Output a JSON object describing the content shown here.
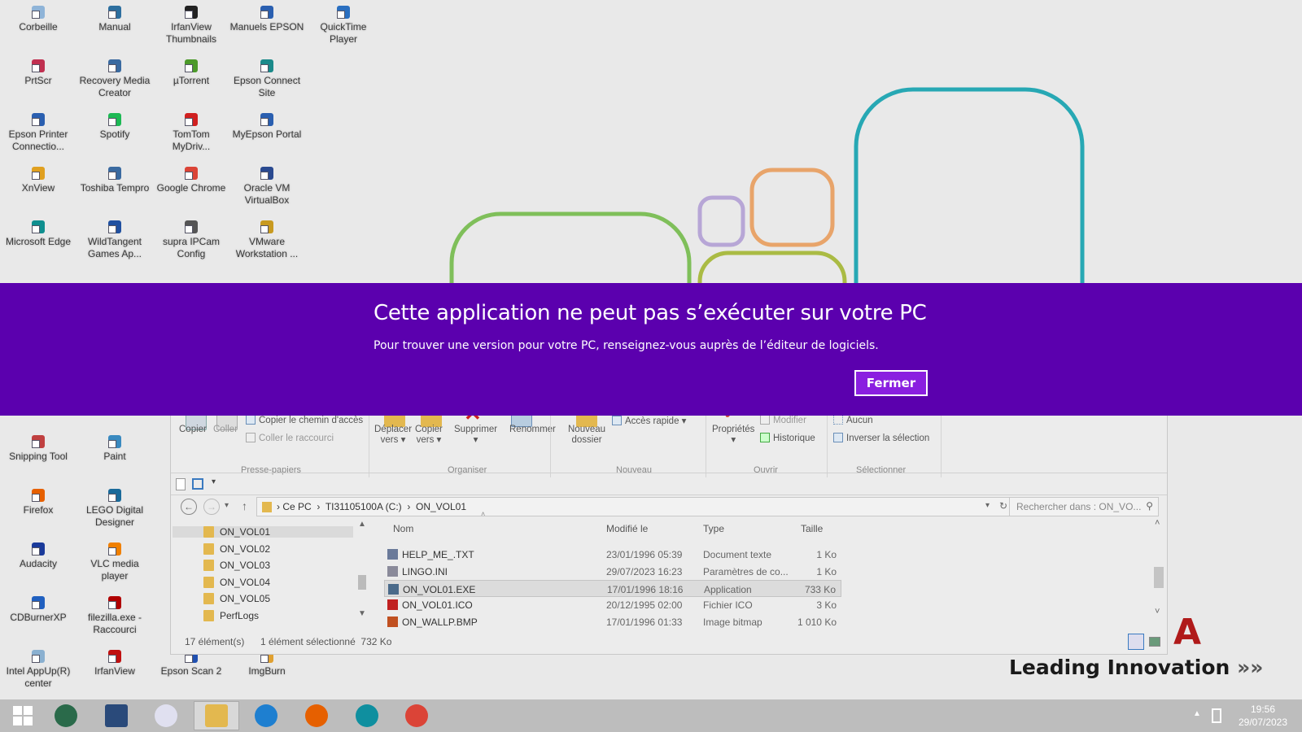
{
  "desktop": {
    "icons": [
      {
        "label": "Corbeille",
        "color": "#8fb4d8"
      },
      {
        "label": "Manual",
        "color": "#2d6f9f"
      },
      {
        "label": "IrfanView Thumbnails",
        "color": "#222"
      },
      {
        "label": "Manuels EPSON",
        "color": "#2a5fb0"
      },
      {
        "label": "QuickTime Player",
        "color": "#2a6fc0"
      },
      {
        "label": "PrtScr",
        "color": "#c03050"
      },
      {
        "label": "Recovery Media Creator",
        "color": "#3a6aa0"
      },
      {
        "label": "µTorrent",
        "color": "#4c9a2a"
      },
      {
        "label": "Epson Connect Site",
        "color": "#1b8a8a"
      },
      {
        "label": "Epson Printer Connectio...",
        "color": "#2a5fb0"
      },
      {
        "label": "Spotify",
        "color": "#1db954"
      },
      {
        "label": "TomTom MyDriv...",
        "color": "#d02020"
      },
      {
        "label": "MyEpson Portal",
        "color": "#2a5fb0"
      },
      {
        "label": "XnView",
        "color": "#e0a020"
      },
      {
        "label": "Toshiba Tempro",
        "color": "#3a6aa0"
      },
      {
        "label": "Google Chrome",
        "color": "#db4437"
      },
      {
        "label": "Oracle VM VirtualBox",
        "color": "#2a4a90"
      },
      {
        "label": "Microsoft Edge",
        "color": "#0f8f8f"
      },
      {
        "label": "WildTangent Games Ap...",
        "color": "#2050a0"
      },
      {
        "label": "supra IPCam Config",
        "color": "#555"
      },
      {
        "label": "VMware Workstation ...",
        "color": "#c89a20"
      },
      {
        "label": "Snipping Tool",
        "color": "#c04040"
      },
      {
        "label": "Paint",
        "color": "#3a8ac0"
      },
      {
        "label": "Firefox",
        "color": "#e66000"
      },
      {
        "label": "LEGO Digital Designer",
        "color": "#1a6a9a"
      },
      {
        "label": "Audacity",
        "color": "#1a3a9a"
      },
      {
        "label": "VLC media player",
        "color": "#f08000"
      },
      {
        "label": "CDBurnerXP",
        "color": "#2060c0"
      },
      {
        "label": "filezilla.exe - Raccourci",
        "color": "#b00000"
      },
      {
        "label": "Intel AppUp(R) center",
        "color": "#8ab0d0"
      },
      {
        "label": "IrfanView",
        "color": "#c01010"
      },
      {
        "label": "Epson Scan 2",
        "color": "#2050b0"
      },
      {
        "label": "ImgBurn",
        "color": "#e0a030"
      }
    ]
  },
  "dialog": {
    "title": "Cette application ne peut pas s’exécuter sur votre PC",
    "message": "Pour trouver une version pour votre PC, renseignez-vous auprès de l’éditeur de logiciels.",
    "close_label": "Fermer",
    "background": "#5b00ae"
  },
  "ribbon": {
    "copy": "Copier",
    "paste": "Coller",
    "copy_path": "Copier le chemin d'accès",
    "paste_shortcut": "Coller le raccourci",
    "move_to": [
      "Déplacer",
      "vers"
    ],
    "copy_to": [
      "Copier",
      "vers"
    ],
    "delete": "Supprimer",
    "rename": "Renommer",
    "new_folder": [
      "Nouveau",
      "dossier"
    ],
    "quick_access": "Accès rapide",
    "properties": "Propriétés",
    "edit": "Modifier",
    "history": "Historique",
    "select_none": "Aucun",
    "invert_selection": "Inverser la sélection",
    "groups": {
      "clipboard": "Presse-papiers",
      "organize": "Organiser",
      "new": "Nouveau",
      "open": "Ouvrir",
      "select": "Sélectionner"
    }
  },
  "address": {
    "crumbs": [
      "Ce PC",
      "TI31105100A (C:)",
      "ON_VOL01"
    ],
    "search_placeholder": "Rechercher dans : ON_VO..."
  },
  "tree": [
    "ON_VOL01",
    "ON_VOL02",
    "ON_VOL03",
    "ON_VOL04",
    "ON_VOL05",
    "PerfLogs"
  ],
  "files": {
    "columns": [
      "Nom",
      "Modifié le",
      "Type",
      "Taille"
    ],
    "rows": [
      {
        "name": "HELP_ME_.TXT",
        "modified": "23/01/1996 05:39",
        "type": "Document texte",
        "size": "1 Ko",
        "icon": "#6a7a9a"
      },
      {
        "name": "LINGO.INI",
        "modified": "29/07/2023 16:23",
        "type": "Paramètres de co...",
        "size": "1 Ko",
        "icon": "#8a8a9a"
      },
      {
        "name": "ON_VOL01.EXE",
        "modified": "17/01/1996 18:16",
        "type": "Application",
        "size": "733 Ko",
        "icon": "#4a6a8a",
        "selected": true
      },
      {
        "name": "ON_VOL01.ICO",
        "modified": "20/12/1995 02:00",
        "type": "Fichier ICO",
        "size": "3 Ko",
        "icon": "#c02020"
      },
      {
        "name": "ON_WALLP.BMP",
        "modified": "17/01/1996 01:33",
        "type": "Image bitmap",
        "size": "1 010 Ko",
        "icon": "#c05020"
      }
    ]
  },
  "status": {
    "count": "17 élément(s)",
    "selection": "1 élément sélectionné  732 Ko"
  },
  "wallpaper": {
    "logo_letter": "A",
    "slogan": "Leading Innovation",
    "arrows": "»»"
  },
  "taskbar": {
    "apps": [
      "Démarrer",
      "Lecteur",
      "Connexion bureau",
      "Paint",
      "Explorateur",
      "Internet Explorer",
      "Firefox",
      "Edge",
      "Chrome"
    ],
    "time": "19:56",
    "date": "29/07/2023"
  }
}
